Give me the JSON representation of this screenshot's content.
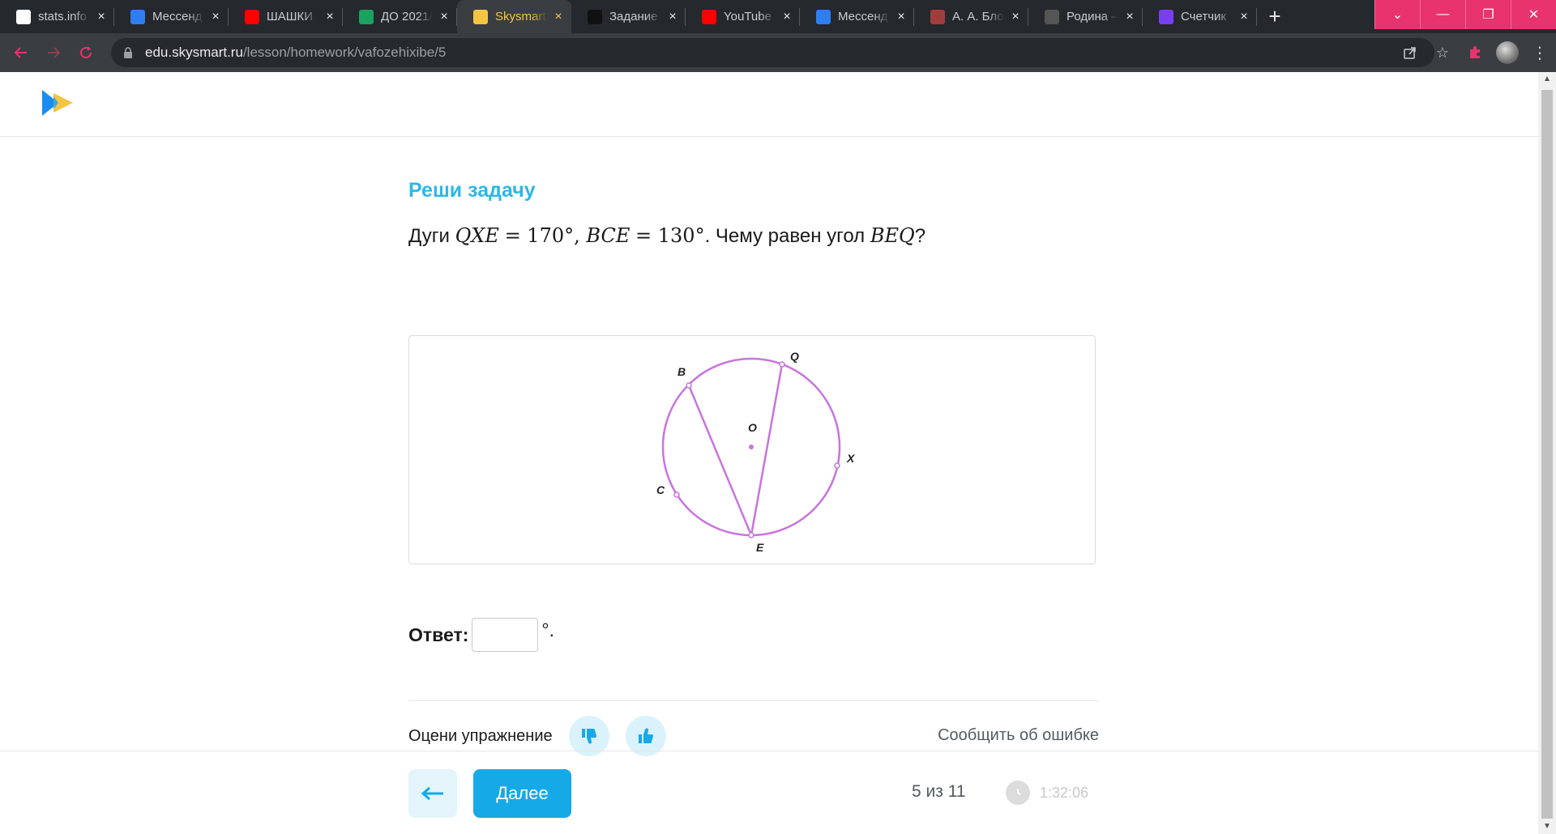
{
  "browser": {
    "tabs": [
      {
        "title": "stats.info",
        "icon": "stats-icon",
        "color": "#ffffff",
        "active": false
      },
      {
        "title": "Мессенд",
        "icon": "messenger-icon",
        "color": "#2f7ef0",
        "active": false
      },
      {
        "title": "ШАШКИ",
        "icon": "youtube-icon",
        "color": "#ff0000",
        "active": false
      },
      {
        "title": "ДО 2021/",
        "icon": "sheets-icon",
        "color": "#1aa260",
        "active": false
      },
      {
        "title": "Skysmart",
        "icon": "skysmart-icon",
        "color": "#f5c542",
        "active": true
      },
      {
        "title": "Задание",
        "icon": "zadanie-icon",
        "color": "#111111",
        "active": false
      },
      {
        "title": "YouTube",
        "icon": "youtube-icon",
        "color": "#ff0000",
        "active": false
      },
      {
        "title": "Мессенд",
        "icon": "messenger-icon",
        "color": "#2f7ef0",
        "active": false
      },
      {
        "title": "А. А. Бло",
        "icon": "book-icon",
        "color": "#a33d3d",
        "active": false
      },
      {
        "title": "Родина –",
        "icon": "k-icon",
        "color": "#555555",
        "active": false
      },
      {
        "title": "Счетчик",
        "icon": "s-icon",
        "color": "#7b3ff2",
        "active": false
      }
    ],
    "url_host": "edu.skysmart.ru",
    "url_path": "/lesson/homework/vafozehixibe/5",
    "accent_color": "#e8336f"
  },
  "task": {
    "heading": "Реши задачу",
    "question_prefix": "Дуги ",
    "arc1_name": "QXE",
    "arc1_value": "= 170°",
    "comma": ", ",
    "arc2_name": "BCE",
    "arc2_value": "= 130°",
    "question_mid": ". Чему равен угол ",
    "angle_name": "BEQ",
    "question_end": "?",
    "figure_labels": {
      "B": "B",
      "Q": "Q",
      "O": "O",
      "X": "X",
      "C": "C",
      "E": "E"
    }
  },
  "answer": {
    "label": "Ответ:",
    "value": "",
    "suffix": "°."
  },
  "rating": {
    "label": "Оцени упражнение",
    "report": "Сообщить об ошибке"
  },
  "footer": {
    "next_label": "Далее",
    "progress": "5 из 11",
    "timer": "1:32:06"
  }
}
